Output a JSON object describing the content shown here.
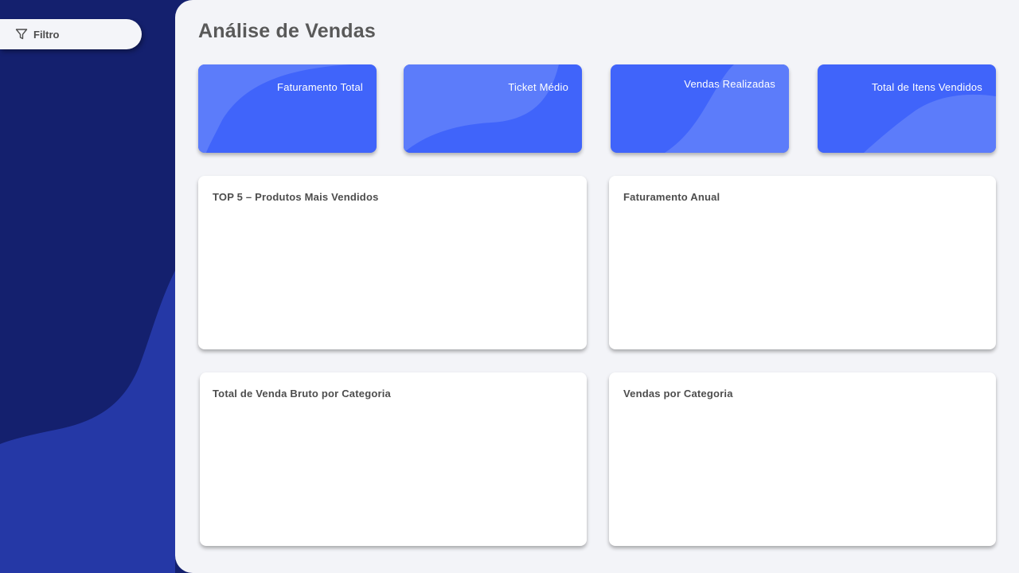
{
  "sidebar": {
    "filter_button": {
      "label": "Filtro",
      "icon": "filter-icon"
    }
  },
  "page": {
    "title": "Análise de Vendas"
  },
  "kpis": [
    {
      "label": "Faturamento  Total"
    },
    {
      "label": "Ticket  Médio"
    },
    {
      "label": "Vendas  Realizadas"
    },
    {
      "label": "Total  de Itens Vendidos"
    }
  ],
  "panels": [
    {
      "title": "TOP 5 – Produtos  Mais  Vendidos"
    },
    {
      "title": "Faturamento  Anual"
    },
    {
      "title": "Total  de  Venda  Bruto  por  Categoria"
    },
    {
      "title": "Vendas  por  Categoria"
    }
  ],
  "colors": {
    "sidebar_dark": "#14206e",
    "sidebar_wave": "#2538a6",
    "main_background": "#f3f4f8",
    "kpi_base": "#4064fa",
    "kpi_wave": "#5c7cfa"
  }
}
